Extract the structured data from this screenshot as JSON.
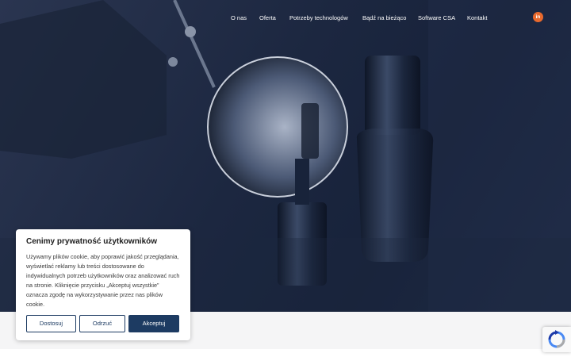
{
  "nav": {
    "items": [
      "O nas",
      "Oferta",
      "Potrzeby technologów",
      "Bądź na bieżąco",
      "Software CSA",
      "Kontakt"
    ]
  },
  "social": {
    "linkedin_label": "in",
    "linkedin_icon": "linkedin-icon",
    "color": "#e8692d"
  },
  "cookie": {
    "title": "Cenimy prywatność użytkowników",
    "text": "Używamy plików cookie, aby poprawić jakość przeglądania, wyświetlać reklamy lub treści dostosowane do indywidualnych potrzeb użytkowników oraz analizować ruch na stronie. Kliknięcie przycisku „Akceptuj wszystkie” oznacza zgodę na wykorzystywanie przez nas plików cookie.",
    "buttons": {
      "customize": "Dostosuj",
      "reject": "Odrzuć",
      "accept": "Akceptuj"
    },
    "accent": "#1d3b62"
  },
  "recaptcha": {
    "icon": "recaptcha-icon"
  }
}
